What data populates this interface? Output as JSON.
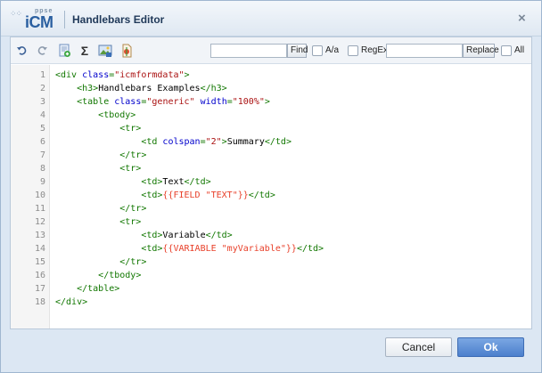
{
  "window": {
    "title": "Handlebars Editor",
    "logo_small": "ppse",
    "logo_main": "iCM",
    "close_glyph": "×"
  },
  "toolbar": {
    "icons": [
      "undo-icon",
      "redo-icon",
      "insert-field-icon",
      "sigma-icon",
      "insert-image-icon",
      "insert-variable-icon"
    ],
    "sigma_glyph": "Σ",
    "find_value": "",
    "find_label": "Find",
    "match_case_label": "A/a",
    "regex_label": "RegEx",
    "replace_value": "",
    "replace_label": "Replace",
    "all_label": "All"
  },
  "editor": {
    "line_numbers": [
      "1",
      "2",
      "3",
      "4",
      "5",
      "6",
      "7",
      "8",
      "9",
      "10",
      "11",
      "12",
      "13",
      "14",
      "15",
      "16",
      "17",
      "18"
    ],
    "lines": [
      [
        {
          "c": "t",
          "v": "<div "
        },
        {
          "c": "a",
          "v": "class"
        },
        {
          "c": "t",
          "v": "="
        },
        {
          "c": "s",
          "v": "\"icmformdata\""
        },
        {
          "c": "t",
          "v": ">"
        }
      ],
      [
        {
          "c": "p",
          "v": "    "
        },
        {
          "c": "t",
          "v": "<h3>"
        },
        {
          "c": "p",
          "v": "Handlebars Examples"
        },
        {
          "c": "t",
          "v": "</h3>"
        }
      ],
      [
        {
          "c": "p",
          "v": "    "
        },
        {
          "c": "t",
          "v": "<table "
        },
        {
          "c": "a",
          "v": "class"
        },
        {
          "c": "t",
          "v": "="
        },
        {
          "c": "s",
          "v": "\"generic\""
        },
        {
          "c": "p",
          "v": " "
        },
        {
          "c": "a",
          "v": "width"
        },
        {
          "c": "t",
          "v": "="
        },
        {
          "c": "s",
          "v": "\"100%\""
        },
        {
          "c": "t",
          "v": ">"
        }
      ],
      [
        {
          "c": "p",
          "v": "        "
        },
        {
          "c": "t",
          "v": "<tbody>"
        }
      ],
      [
        {
          "c": "p",
          "v": "            "
        },
        {
          "c": "t",
          "v": "<tr>"
        }
      ],
      [
        {
          "c": "p",
          "v": "                "
        },
        {
          "c": "t",
          "v": "<td "
        },
        {
          "c": "a",
          "v": "colspan"
        },
        {
          "c": "t",
          "v": "="
        },
        {
          "c": "s",
          "v": "\"2\""
        },
        {
          "c": "t",
          "v": ">"
        },
        {
          "c": "p",
          "v": "Summary"
        },
        {
          "c": "t",
          "v": "</td>"
        }
      ],
      [
        {
          "c": "p",
          "v": "            "
        },
        {
          "c": "t",
          "v": "</tr>"
        }
      ],
      [
        {
          "c": "p",
          "v": "            "
        },
        {
          "c": "t",
          "v": "<tr>"
        }
      ],
      [
        {
          "c": "p",
          "v": "                "
        },
        {
          "c": "t",
          "v": "<td>"
        },
        {
          "c": "p",
          "v": "Text"
        },
        {
          "c": "t",
          "v": "</td>"
        }
      ],
      [
        {
          "c": "p",
          "v": "                "
        },
        {
          "c": "t",
          "v": "<td>"
        },
        {
          "c": "hb",
          "v": "{{FIELD \"TEXT\"}}"
        },
        {
          "c": "t",
          "v": "</td>"
        }
      ],
      [
        {
          "c": "p",
          "v": "            "
        },
        {
          "c": "t",
          "v": "</tr>"
        }
      ],
      [
        {
          "c": "p",
          "v": "            "
        },
        {
          "c": "t",
          "v": "<tr>"
        }
      ],
      [
        {
          "c": "p",
          "v": "                "
        },
        {
          "c": "t",
          "v": "<td>"
        },
        {
          "c": "p",
          "v": "Variable"
        },
        {
          "c": "t",
          "v": "</td>"
        }
      ],
      [
        {
          "c": "p",
          "v": "                "
        },
        {
          "c": "t",
          "v": "<td>"
        },
        {
          "c": "hb",
          "v": "{{VARIABLE \"myVariable\"}}"
        },
        {
          "c": "t",
          "v": "</td>"
        }
      ],
      [
        {
          "c": "p",
          "v": "            "
        },
        {
          "c": "t",
          "v": "</tr>"
        }
      ],
      [
        {
          "c": "p",
          "v": "        "
        },
        {
          "c": "t",
          "v": "</tbody>"
        }
      ],
      [
        {
          "c": "p",
          "v": "    "
        },
        {
          "c": "t",
          "v": "</table>"
        }
      ],
      [
        {
          "c": "t",
          "v": "</div>"
        }
      ]
    ]
  },
  "footer": {
    "cancel_label": "Cancel",
    "ok_label": "Ok"
  },
  "colors": {
    "tag": "#117700",
    "attr": "#0000cc",
    "string": "#aa1111",
    "handlebars": "#e8402a",
    "ok_button": "#4b7fcc"
  }
}
